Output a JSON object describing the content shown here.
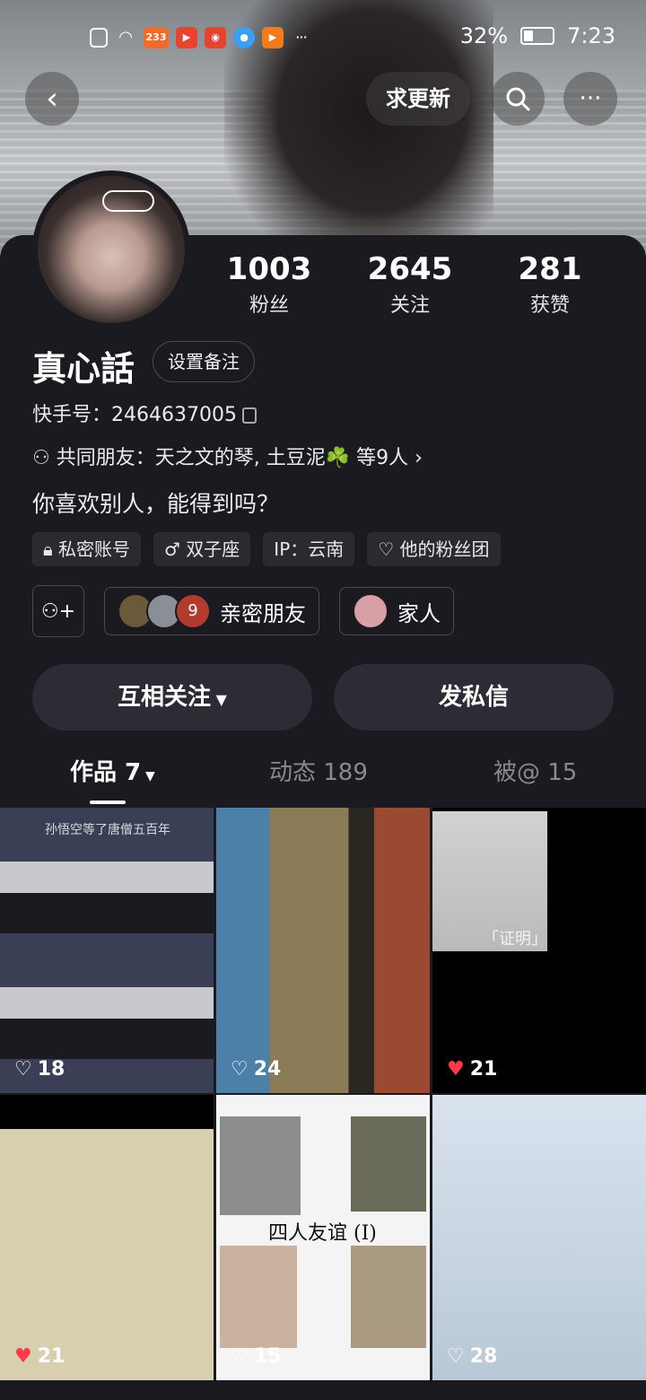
{
  "status_bar": {
    "battery": "32%",
    "time": "7:23",
    "notif_badge": "233",
    "more": "···"
  },
  "header": {
    "update_request": "求更新",
    "more_label": "···"
  },
  "profile": {
    "stats": [
      {
        "value": "1003",
        "label": "粉丝"
      },
      {
        "value": "2645",
        "label": "关注"
      },
      {
        "value": "281",
        "label": "获赞"
      }
    ],
    "nickname": "真心話",
    "remark_button": "设置备注",
    "kuaishou_id": "快手号：2464637005",
    "mutual_friends": "共同朋友：天之文的琴, 土豆泥☘️ 等9人",
    "bio": "你喜欢别人，能得到吗？",
    "tags": [
      {
        "icon": "lock-icon",
        "label": "私密账号"
      },
      {
        "icon": "male-icon",
        "label": "双子座"
      },
      {
        "icon": "location-icon",
        "label": "IP：云南"
      },
      {
        "icon": "heart-outline-icon",
        "label": "他的粉丝团"
      }
    ],
    "relations": {
      "close_friends": "亲密朋友",
      "family": "家人",
      "avatar_number": "9"
    }
  },
  "actions": {
    "mutual_follow": "互相关注",
    "message": "发私信"
  },
  "tabs": [
    {
      "label": "作品 7",
      "active": true
    },
    {
      "label": "动态 189",
      "active": false
    },
    {
      "label": "被@ 15",
      "active": false
    }
  ],
  "posts": [
    {
      "likes": "18",
      "liked": false,
      "caption": "孙悟空等了唐僧五百年"
    },
    {
      "likes": "24",
      "liked": false,
      "caption": ""
    },
    {
      "likes": "21",
      "liked": true,
      "caption": "「证明」"
    },
    {
      "likes": "21",
      "liked": true,
      "caption": ""
    },
    {
      "likes": "15",
      "liked": false,
      "caption": "四人友谊 (I)"
    },
    {
      "likes": "28",
      "liked": false,
      "caption": ""
    }
  ],
  "colors": {
    "background": "#1c1a21",
    "button": "#2d2b33",
    "like_red": "#ff3b4a"
  }
}
